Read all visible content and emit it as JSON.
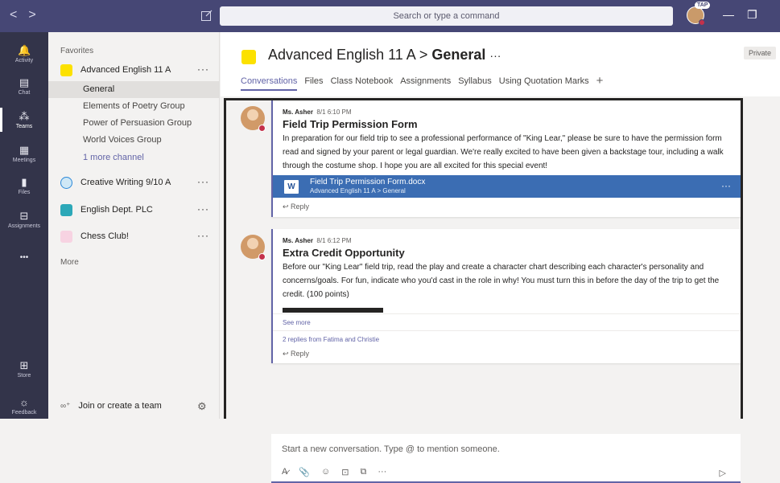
{
  "titlebar": {
    "search_placeholder": "Search or type a command",
    "avatar_badge": "TAP",
    "back_glyph": "<",
    "forward_glyph": ">",
    "minimize_glyph": "—",
    "maximize_glyph": "❐"
  },
  "rail": {
    "items": [
      {
        "label": "Activity",
        "icon": "bell-icon",
        "glyph": "🔔"
      },
      {
        "label": "Chat",
        "icon": "chat-icon",
        "glyph": "▤"
      },
      {
        "label": "Teams",
        "icon": "teams-icon",
        "glyph": "⁂"
      },
      {
        "label": "Meetings",
        "icon": "calendar-icon",
        "glyph": "▦"
      },
      {
        "label": "Files",
        "icon": "file-icon",
        "glyph": "▮"
      },
      {
        "label": "Assignments",
        "icon": "backpack-icon",
        "glyph": "⊟"
      },
      {
        "label": "",
        "icon": "more-icon",
        "glyph": "•••"
      },
      {
        "label": "Store",
        "icon": "store-icon",
        "glyph": "⊞"
      },
      {
        "label": "Feedback",
        "icon": "feedback-icon",
        "glyph": "☼"
      }
    ]
  },
  "teams": {
    "favorites_label": "Favorites",
    "more_label": "More",
    "join_label": "Join or create a team",
    "list": [
      {
        "name": "Advanced English 11 A",
        "color": "#fce100",
        "dots": "···"
      },
      {
        "name": "Creative Writing 9/10 A",
        "color": "#cfe8f6",
        "dots": "···"
      },
      {
        "name": "English Dept. PLC",
        "color": "#2ca8b8",
        "dots": "···"
      },
      {
        "name": "Chess Club!",
        "color": "#f7d3e2",
        "dots": "···"
      }
    ],
    "channels": [
      "General",
      "Elements of Poetry Group",
      "Power of Persuasion Group",
      "World Voices Group",
      "1 more channel"
    ]
  },
  "channel": {
    "team": "Advanced English 11 A",
    "separator": ">",
    "name": "General",
    "dots": "···",
    "private_label": "Private",
    "tabs": [
      "Conversations",
      "Files",
      "Class Notebook",
      "Assignments",
      "Syllabus",
      "Using Quotation Marks"
    ],
    "add_tab_glyph": "+"
  },
  "posts": [
    {
      "author": "Ms. Asher",
      "time": "8/1 6:10 PM",
      "title": "Field Trip Permission Form",
      "body": "In preparation for our field trip to see a professional performance of \"King Lear,\" please be sure to have the permission form read and signed by your parent or legal guardian. We're really excited to have been given a backstage tour, including a walk through the costume shop. I hope you are all excited for this special event!",
      "attachment": {
        "name": "Field Trip Permission Form.docx",
        "path": "Advanced English 11 A > General",
        "icon_letter": "W",
        "dots": "···"
      },
      "reply": "↩ Reply"
    },
    {
      "author": "Ms. Asher",
      "time": "8/1 6:12 PM",
      "title": "Extra Credit Opportunity",
      "body": "Before our \"King Lear\" field trip, read the play and create a character chart describing each character's personality and concerns/goals. For fun, indicate who you'd cast in the role in why! You must turn this in before the day of the trip to get the credit. (100 points)",
      "see_more": "See more",
      "replies_summary": "2 replies from Fatima and Christie",
      "reply": "↩ Reply"
    }
  ],
  "compose": {
    "placeholder": "Start a new conversation. Type @ to mention someone.",
    "tools": [
      "A̷",
      "📎",
      "☺",
      "⊡",
      "⧉",
      "···"
    ],
    "send_glyph": "▷"
  }
}
